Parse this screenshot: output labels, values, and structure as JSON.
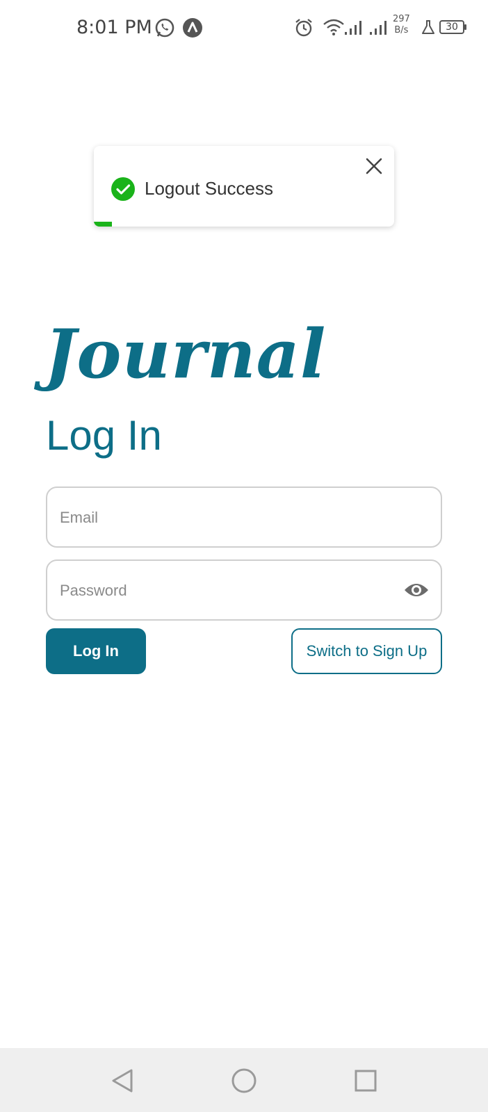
{
  "status_bar": {
    "time": "8:01 PM",
    "net_speed_value": "297",
    "net_speed_unit": "B/s",
    "battery_level": "30",
    "icons": [
      "whatsapp-icon",
      "app-notification-icon",
      "alarm-icon",
      "wifi-icon",
      "signal-icon",
      "signal-icon",
      "lab-icon",
      "battery-icon"
    ]
  },
  "toast": {
    "message": "Logout Success",
    "progress_fraction": 0.06,
    "accent_color": "#1ab31a"
  },
  "app": {
    "logo_text": "Journal",
    "brand_color": "#0d6e87"
  },
  "form": {
    "title": "Log In",
    "email_placeholder": "Email",
    "email_value": "",
    "password_placeholder": "Password",
    "password_value": "",
    "login_button": "Log In",
    "switch_button": "Switch to Sign Up"
  },
  "nav_bar": {
    "buttons": [
      "back-icon",
      "home-icon",
      "recents-icon"
    ]
  }
}
